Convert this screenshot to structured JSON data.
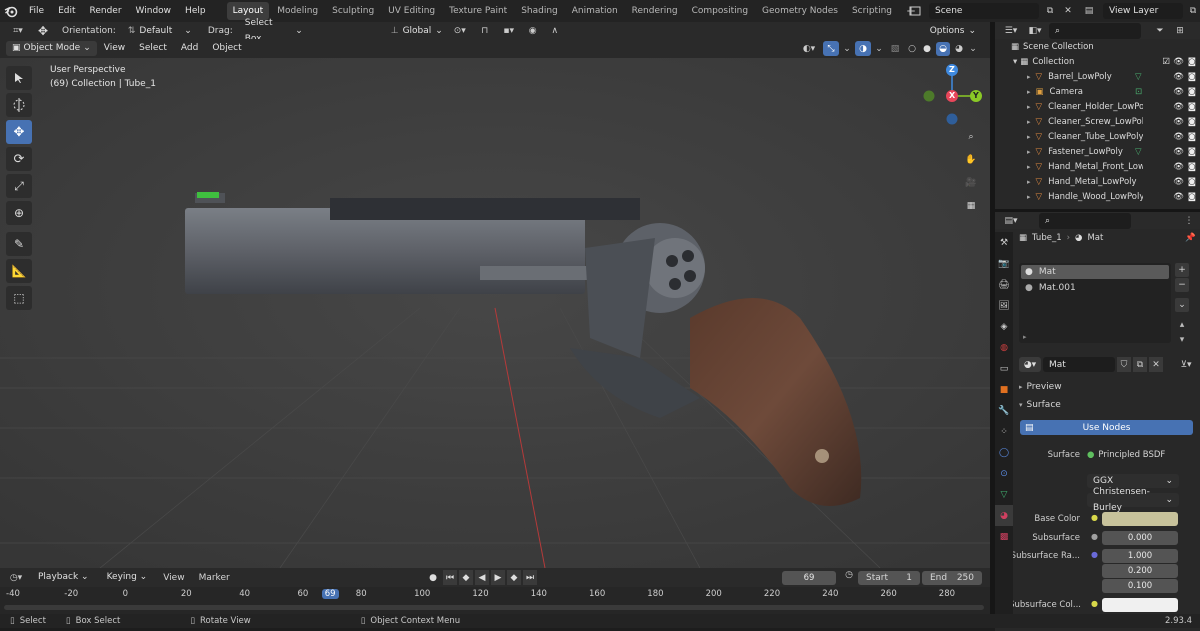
{
  "menubar": {
    "menus": [
      "File",
      "Edit",
      "Render",
      "Window",
      "Help"
    ],
    "workspaces": [
      "Layout",
      "Modeling",
      "Sculpting",
      "UV Editing",
      "Texture Paint",
      "Shading",
      "Animation",
      "Rendering",
      "Compositing",
      "Geometry Nodes",
      "Scripting"
    ],
    "active_workspace": "Layout",
    "add_tab": "+",
    "scene": "Scene",
    "view_layer": "View Layer"
  },
  "tool_header": {
    "orientation_label": "Orientation:",
    "orientation_value": "Default",
    "drag_label": "Drag:",
    "drag_value": "Select Box",
    "transform_space": "Global",
    "options_label": "Options"
  },
  "view_header": {
    "mode": "Object Mode",
    "menus": [
      "View",
      "Select",
      "Add",
      "Object"
    ]
  },
  "viewport": {
    "perspective": "User Perspective",
    "collection_info": "(69) Collection | Tube_1",
    "gizmo": {
      "z": "Z",
      "x": "X",
      "y": "Y"
    },
    "colors": {
      "x_axis": "#e8465a",
      "y_axis": "#8ac926",
      "z_axis": "#3f8ae0",
      "background": "#3e3e3e"
    }
  },
  "outliner": {
    "root": "Scene Collection",
    "collection": "Collection",
    "items": [
      {
        "name": "Barrel_LowPoly",
        "icon": "mesh-icon",
        "extra": "mesh-data-icon"
      },
      {
        "name": "Camera",
        "icon": "camera-icon",
        "extra": "camera-data-icon"
      },
      {
        "name": "Cleaner_Holder_LowPoly",
        "icon": "mesh-icon",
        "extra": ""
      },
      {
        "name": "Cleaner_Screw_LowPoly",
        "icon": "mesh-icon",
        "extra": ""
      },
      {
        "name": "Cleaner_Tube_LowPoly",
        "icon": "mesh-icon",
        "extra": ""
      },
      {
        "name": "Fastener_LowPoly",
        "icon": "mesh-icon",
        "extra": "mesh-data-icon"
      },
      {
        "name": "Hand_Metal_Front_LowPo",
        "icon": "mesh-icon",
        "extra": ""
      },
      {
        "name": "Hand_Metal_LowPoly",
        "icon": "mesh-icon",
        "extra": ""
      },
      {
        "name": "Handle_Wood_LowPoly",
        "icon": "mesh-icon",
        "extra": ""
      }
    ]
  },
  "properties": {
    "object_name": "Tube_1",
    "material_name": "Mat",
    "slots": [
      "Mat",
      "Mat.001"
    ],
    "active_slot": "Mat",
    "material_field": "Mat",
    "panels": {
      "preview": "Preview",
      "surface": "Surface"
    },
    "use_nodes": "Use Nodes",
    "surface_label": "Surface",
    "surface_value": "Principled BSDF",
    "distribution": "GGX",
    "subsurface_method": "Christensen-Burley",
    "base_color_label": "Base Color",
    "base_color": "#c7c29b",
    "subsurface_label": "Subsurface",
    "subsurface_value": "0.000",
    "subsurface_radius_label": "Subsurface Ra...",
    "subsurface_radius": [
      "1.000",
      "0.200",
      "0.100"
    ],
    "subsurface_color_label": "Subsurface Col...",
    "subsurface_color": "#f0f0f0"
  },
  "timeline": {
    "menus": [
      "Playback",
      "Keying",
      "View",
      "Marker"
    ],
    "current_frame": "69",
    "start_label": "Start",
    "start_value": "1",
    "end_label": "End",
    "end_value": "250",
    "ruler": [
      "-40",
      "-20",
      "0",
      "20",
      "40",
      "60",
      "69",
      "80",
      "100",
      "120",
      "140",
      "160",
      "180",
      "200",
      "220",
      "240",
      "260",
      "280"
    ],
    "playhead": "69"
  },
  "statusbar": {
    "select": "Select",
    "box_select": "Box Select",
    "rotate_view": "Rotate View",
    "context_menu": "Object Context Menu",
    "version": "2.93.4"
  },
  "accent": "#4772b3"
}
